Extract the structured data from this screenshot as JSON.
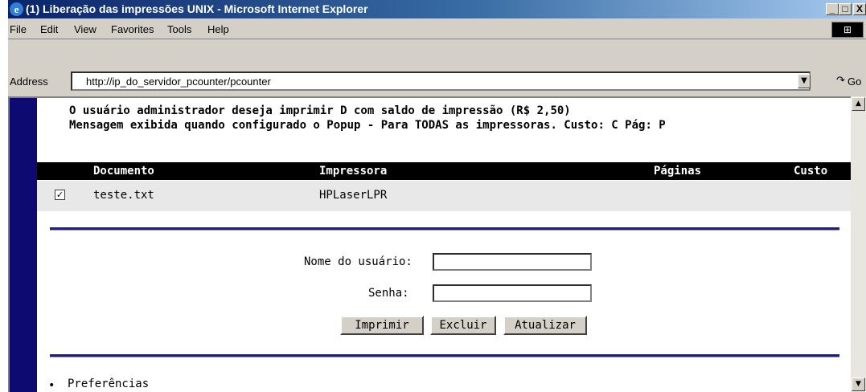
{
  "window": {
    "title": "(1) Liberação das impressões UNIX - Microsoft Internet Explorer",
    "buttons": {
      "minimize": "_",
      "maximize": "□",
      "close": "X"
    }
  },
  "menu": {
    "items": [
      "File",
      "Edit",
      "View",
      "Favorites",
      "Tools",
      "Help"
    ]
  },
  "address_bar": {
    "label": "Address",
    "url": "http://ip_do_servidor_pcounter/pcounter",
    "go_label": "Go"
  },
  "page": {
    "message_line1": "O usuário administrador deseja imprimir D com saldo de impressão (R$ 2,50)",
    "message_line2": "Mensagem exibida quando configurado o Popup - Para TODAS as impressoras.  Custo: C  Pág: P",
    "table": {
      "headers": {
        "document": "Documento",
        "printer": "Impressora",
        "pages": "Páginas",
        "cost": "Custo"
      },
      "rows": [
        {
          "checked": true,
          "document": "teste.txt",
          "printer": "HPLaserLPR",
          "pages": "",
          "cost": ""
        }
      ]
    },
    "form": {
      "username_label": "Nome do usuário:",
      "username_value": "",
      "password_label": "Senha:",
      "password_value": "",
      "print_button": "Imprimir",
      "delete_button": "Excluir",
      "refresh_button": "Atualizar"
    },
    "links": {
      "preferences": "Preferências"
    }
  },
  "colors": {
    "title_bar": "#0a246a",
    "side_strip": "#0d0b71",
    "table_header": "#000000",
    "rule": "#1a1d8a"
  },
  "icons": [
    "ie-icon",
    "windows-logo-icon",
    "go-arrow-icon",
    "scroll-up-icon",
    "scroll-down-icon",
    "checkmark-icon"
  ]
}
